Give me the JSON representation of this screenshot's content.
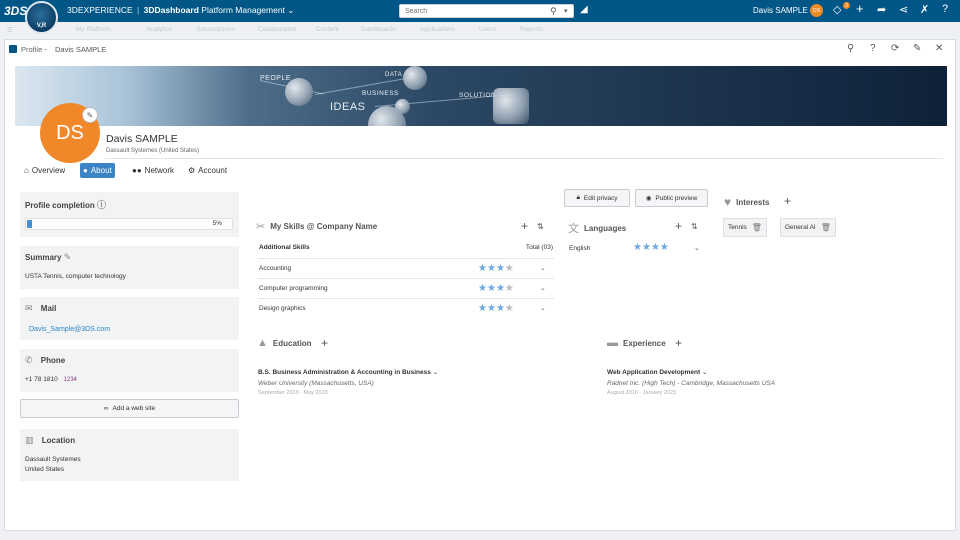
{
  "topbar": {
    "logo": "3DS",
    "compass_label": "V,R",
    "brand": "3DEXPERIENCE",
    "separator": "|",
    "app": "3DDashboard",
    "context": "Platform Management",
    "search_placeholder": "Search",
    "user_name": "Davis SAMPLE",
    "user_initials": "DS",
    "notification_count": "3"
  },
  "subbar": {
    "items": [
      "My Platform",
      "Analytics",
      "Subscriptions",
      "Collaboration",
      "Content",
      "Dashboards",
      "Applications",
      "Users",
      "Reports"
    ]
  },
  "panel": {
    "label": "Profile -",
    "user": "Davis SAMPLE"
  },
  "banner": {
    "words": [
      "PEOPLE",
      "DATA",
      "BUSINESS",
      "IDEAS",
      "SOLUTION"
    ]
  },
  "profile": {
    "initials": "DS",
    "name": "Davis SAMPLE",
    "organization": "Dassault Systemes (United States)"
  },
  "tabs": [
    {
      "label": "Overview",
      "icon": "home-icon"
    },
    {
      "label": "About",
      "icon": "user-icon"
    },
    {
      "label": "Network",
      "icon": "people-icon"
    },
    {
      "label": "Account",
      "icon": "gear-icon"
    }
  ],
  "completion": {
    "title": "Profile completion",
    "percent_label": "5%",
    "value": 0.05
  },
  "summary": {
    "title": "Summary",
    "text": "USTA Tennis, computer technology"
  },
  "mail": {
    "title": "Mail",
    "value": "Davis_Sample@3DS.com"
  },
  "phone": {
    "title": "Phone",
    "value": "+1 78 1810",
    "ext": "1234"
  },
  "website": {
    "button": "Add a web site"
  },
  "location": {
    "title": "Location",
    "line1": "Dassault Systemes",
    "line2": "United States"
  },
  "privacy": {
    "edit": "Edit privacy",
    "preview": "Public preview"
  },
  "skills": {
    "title": "My Skills @ Company Name",
    "sub_header": "Additional Skills",
    "total": "Total (03)",
    "items": [
      {
        "name": "Accounting",
        "rating": 3,
        "max": 4
      },
      {
        "name": "Computer programming",
        "rating": 3,
        "max": 4
      },
      {
        "name": "Design graphics",
        "rating": 3,
        "max": 4
      }
    ]
  },
  "languages": {
    "title": "Languages",
    "items": [
      {
        "name": "English",
        "rating": 4,
        "max": 4
      }
    ]
  },
  "interests": {
    "title": "Interests",
    "items": [
      "Tennis",
      "General AI"
    ]
  },
  "education": {
    "title": "Education",
    "degree": "B.S. Business Administration & Accounting in Business",
    "school": "Weber University (Massachusetts, USA)",
    "dates": "September 2019 - May 2023"
  },
  "experience": {
    "title": "Experience",
    "role": "Web Application Development",
    "company": "Radnet Inc. (High Tech) - Cambridge, Massachusetts USA",
    "dates": "August 2016 - January 2023"
  },
  "colors": {
    "topbar": "#005686",
    "accent": "#3d84c5",
    "avatar": "#f0882a",
    "star_on": "#6ba7e0",
    "link": "#2a84c4"
  }
}
